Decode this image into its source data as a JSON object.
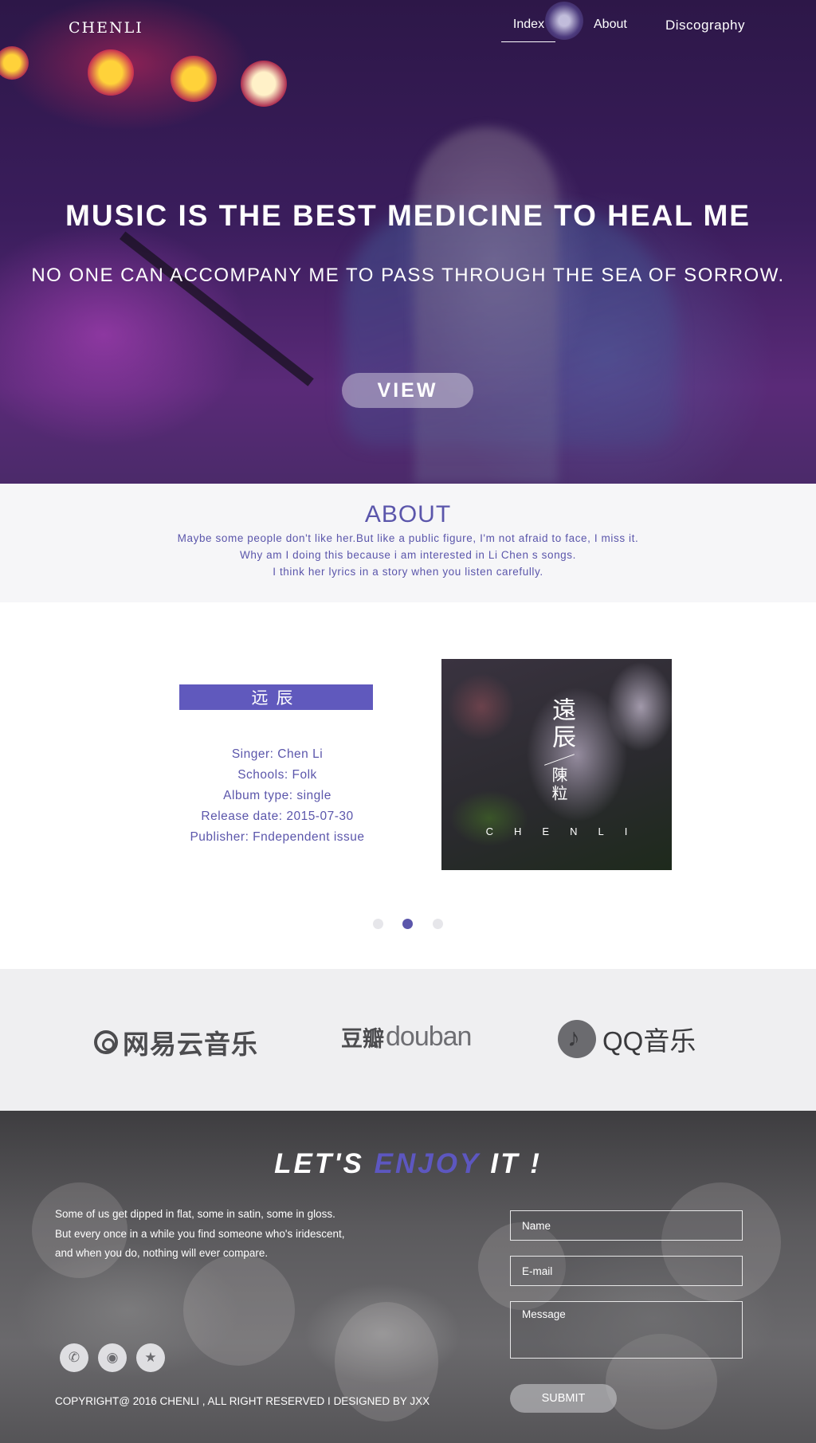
{
  "brand": "CHENLI",
  "nav": {
    "items": [
      {
        "label": "Index",
        "active": true
      },
      {
        "label": "About",
        "active": false
      },
      {
        "label": "Discography",
        "active": false
      }
    ]
  },
  "hero": {
    "title": "MUSIC IS THE BEST MEDICINE TO HEAL ME",
    "subtitle": "NO ONE CAN ACCOMPANY ME TO PASS THROUGH THE SEA OF SORROW.",
    "view_label": "VIEW"
  },
  "about": {
    "heading": "ABOUT",
    "lines": [
      "Maybe some people don't like her.But like a public figure, I'm not afraid to face, I miss it.",
      "Why am I doing this because i am interested in Li Chen s songs.",
      "I think her lyrics in a story when you listen carefully."
    ]
  },
  "album": {
    "title": "远辰",
    "singer": "Singer: Chen Li",
    "schools": "Schools: Folk",
    "type": "Album type: single",
    "release": "Release date: 2015-07-30",
    "publisher": "Publisher: Fndependent issue",
    "cover_title": "遠辰",
    "cover_artist": "陳粒",
    "cover_name": "CHENLI"
  },
  "carousel": {
    "slides": 3,
    "active_index": 1
  },
  "platforms": {
    "netease": "网易云音乐",
    "douban_cn": "豆瓣",
    "douban_en": "douban",
    "qq": "QQ音乐"
  },
  "footer": {
    "slogan_part1": "LET'S ",
    "slogan_accent": "ENJOY",
    "slogan_part2": " IT !",
    "text_lines": [
      "Some of us get dipped in flat, some in satin, some in gloss.",
      "But every once in a while you find someone who's iridescent,",
      "and when you do, nothing will ever compare."
    ],
    "form": {
      "name_placeholder": "Name",
      "email_placeholder": "E-mail",
      "message_placeholder": "Message",
      "submit_label": "SUBMIT"
    },
    "social": [
      {
        "icon": "wechat-icon",
        "glyph": "✆"
      },
      {
        "icon": "weibo-icon",
        "glyph": "◉"
      },
      {
        "icon": "star-icon",
        "glyph": "★"
      }
    ],
    "copyright": "COPYRIGHT@ 2016 CHENLI , ALL RIGHT RESERVED I DESIGNED BY JXX"
  },
  "colors": {
    "accent": "#5b56ab",
    "album_title_bg": "#6059bd",
    "about_bg": "#f6f6f8",
    "platform_bg": "#efeff1"
  }
}
